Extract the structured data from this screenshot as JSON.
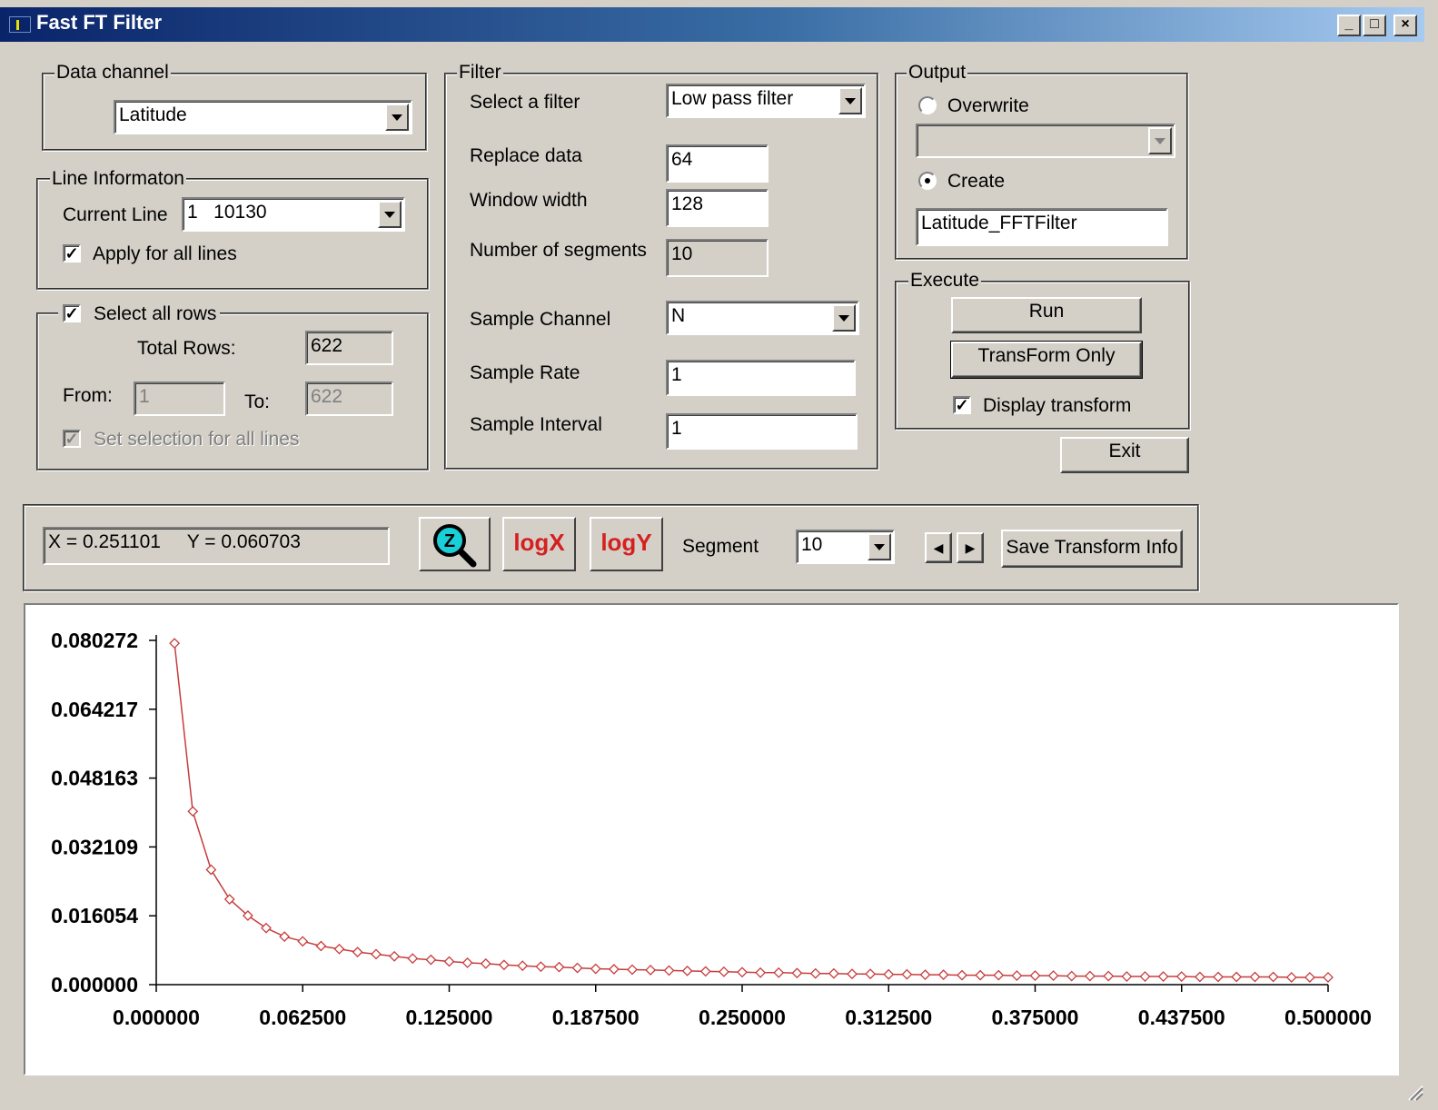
{
  "window": {
    "title": "Fast FT Filter",
    "buttons": [
      "_",
      "□",
      "×"
    ]
  },
  "data_channel": {
    "legend": "Data channel",
    "value": "Latitude"
  },
  "line_info": {
    "legend": "Line Informaton",
    "current_line_label": "Current Line",
    "current_line_value": "1   10130",
    "apply_all_label": "Apply for all lines",
    "apply_all_checked": true
  },
  "rows": {
    "select_all_label": "Select all rows",
    "select_all_checked": true,
    "total_rows_label": "Total Rows:",
    "total_rows_value": "622",
    "from_label": "From:",
    "from_value": "1",
    "to_label": "To:",
    "to_value": "622",
    "set_selection_label": "Set selection for all lines",
    "set_selection_checked": true
  },
  "filter": {
    "legend": "Filter",
    "select_filter_label": "Select a filter",
    "select_filter_value": "Low pass filter",
    "replace_data_label": "Replace data",
    "replace_data_value": "64",
    "window_width_label": "Window width",
    "window_width_value": "128",
    "num_segments_label": "Number of segments",
    "num_segments_value": "10",
    "sample_channel_label": "Sample Channel",
    "sample_channel_value": "N",
    "sample_rate_label": "Sample Rate",
    "sample_rate_value": "1",
    "sample_interval_label": "Sample Interval",
    "sample_interval_value": "1"
  },
  "output": {
    "legend": "Output",
    "overwrite_label": "Overwrite",
    "overwrite_selected": false,
    "overwrite_value": "",
    "create_label": "Create",
    "create_selected": true,
    "create_value": "Latitude_FFTFilter"
  },
  "execute": {
    "legend": "Execute",
    "run_label": "Run",
    "transform_only_label": "TransForm Only",
    "display_transform_label": "Display transform",
    "display_transform_checked": true
  },
  "exit_label": "Exit",
  "toolbar": {
    "coords_text": "X = 0.251101     Y = 0.060703",
    "zoom_icon_letter": "Z",
    "logx_label": "logX",
    "logy_label": "logY",
    "segment_label": "Segment",
    "segment_value": "10",
    "save_label": "Save Transform Info"
  },
  "chart_data": {
    "type": "line",
    "color": "#c83c3c",
    "xlim": [
      0,
      0.5
    ],
    "ylim": [
      0,
      0.080272
    ],
    "x_ticks": [
      "0.000000",
      "0.062500",
      "0.125000",
      "0.187500",
      "0.250000",
      "0.312500",
      "0.375000",
      "0.437500",
      "0.500000"
    ],
    "y_ticks": [
      "0.000000",
      "0.016054",
      "0.032109",
      "0.048163",
      "0.064217",
      "0.080272"
    ],
    "x": [
      0.0078,
      0.0156,
      0.0234,
      0.0313,
      0.0391,
      0.0469,
      0.0547,
      0.0625,
      0.0703,
      0.0781,
      0.0859,
      0.0938,
      0.1016,
      0.1094,
      0.1172,
      0.125,
      0.1328,
      0.1406,
      0.1484,
      0.1563,
      0.1641,
      0.1719,
      0.1797,
      0.1875,
      0.1953,
      0.2031,
      0.2109,
      0.2188,
      0.2266,
      0.2344,
      0.2422,
      0.25,
      0.2578,
      0.2656,
      0.2734,
      0.2813,
      0.2891,
      0.2969,
      0.3047,
      0.3125,
      0.3203,
      0.3281,
      0.3359,
      0.3438,
      0.3516,
      0.3594,
      0.3672,
      0.375,
      0.3828,
      0.3906,
      0.3984,
      0.4063,
      0.4141,
      0.4219,
      0.4297,
      0.4375,
      0.4453,
      0.4531,
      0.4609,
      0.4688,
      0.4766,
      0.4844,
      0.4922,
      0.5
    ],
    "y": [
      0.0796,
      0.0404,
      0.0268,
      0.0199,
      0.0161,
      0.0132,
      0.0112,
      0.0101,
      0.009,
      0.0083,
      0.0076,
      0.0071,
      0.0066,
      0.0061,
      0.0058,
      0.0054,
      0.0051,
      0.0049,
      0.0046,
      0.0044,
      0.0042,
      0.0041,
      0.0039,
      0.0037,
      0.0036,
      0.0035,
      0.0034,
      0.0033,
      0.0032,
      0.0031,
      0.003,
      0.0029,
      0.0028,
      0.0028,
      0.0027,
      0.0026,
      0.0026,
      0.0025,
      0.0025,
      0.0024,
      0.0024,
      0.0023,
      0.0023,
      0.0022,
      0.0022,
      0.0022,
      0.0021,
      0.0021,
      0.0021,
      0.002,
      0.002,
      0.002,
      0.0019,
      0.0019,
      0.0019,
      0.0019,
      0.0018,
      0.0018,
      0.0018,
      0.0018,
      0.0018,
      0.0017,
      0.0017,
      0.0017
    ]
  }
}
